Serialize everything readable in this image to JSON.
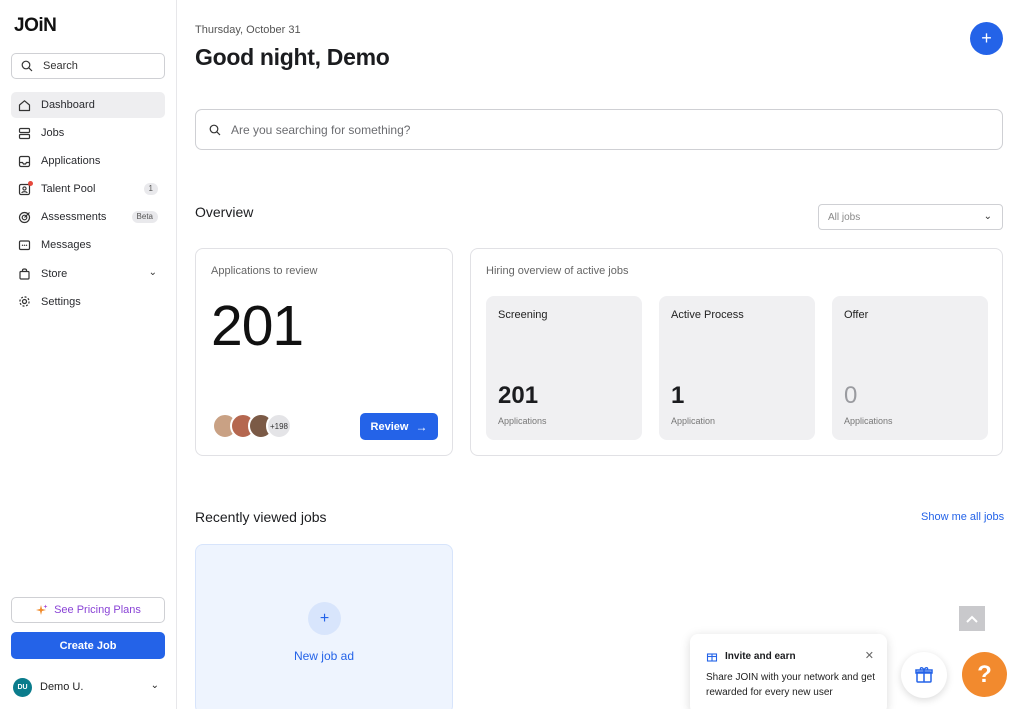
{
  "sidebar": {
    "logo": "JOiN",
    "search_label": "Search",
    "items": [
      {
        "label": "Dashboard",
        "icon": "home-icon"
      },
      {
        "label": "Jobs",
        "icon": "jobs-icon"
      },
      {
        "label": "Applications",
        "icon": "inbox-icon"
      },
      {
        "label": "Talent Pool",
        "icon": "contact-card-icon",
        "badge": "1"
      },
      {
        "label": "Assessments",
        "icon": "target-icon",
        "badge": "Beta"
      },
      {
        "label": "Messages",
        "icon": "message-icon"
      },
      {
        "label": "Store",
        "icon": "shopping-bag-icon"
      },
      {
        "label": "Settings",
        "icon": "gear-icon"
      }
    ],
    "pricing_label": "See Pricing Plans",
    "create_job_label": "Create Job",
    "user": {
      "initials": "DU",
      "name": "Demo U."
    }
  },
  "header": {
    "date": "Thursday, October 31",
    "greeting": "Good night, Demo",
    "add_label": "+"
  },
  "search": {
    "placeholder": "Are you searching for something?"
  },
  "overview": {
    "title": "Overview",
    "filter_value": "All jobs",
    "applications_card": {
      "label": "Applications to review",
      "count": "201",
      "more_count": "+198",
      "review_label": "Review"
    },
    "hiring_card": {
      "label": "Hiring overview of active jobs",
      "stages": [
        {
          "name": "Screening",
          "count": "201",
          "unit": "Applications"
        },
        {
          "name": "Active Process",
          "count": "1",
          "unit": "Application"
        },
        {
          "name": "Offer",
          "count": "0",
          "unit": "Applications"
        }
      ]
    }
  },
  "recent": {
    "title": "Recently viewed jobs",
    "show_all": "Show me all jobs",
    "new_job_label": "New job ad"
  },
  "invite": {
    "title": "Invite and earn",
    "body": "Share JOIN with your network and get rewarded for every new user"
  },
  "help_label": "?",
  "colors": {
    "accent": "#2463e8",
    "help": "#f28a2e",
    "pricing": "#8a44d6"
  }
}
